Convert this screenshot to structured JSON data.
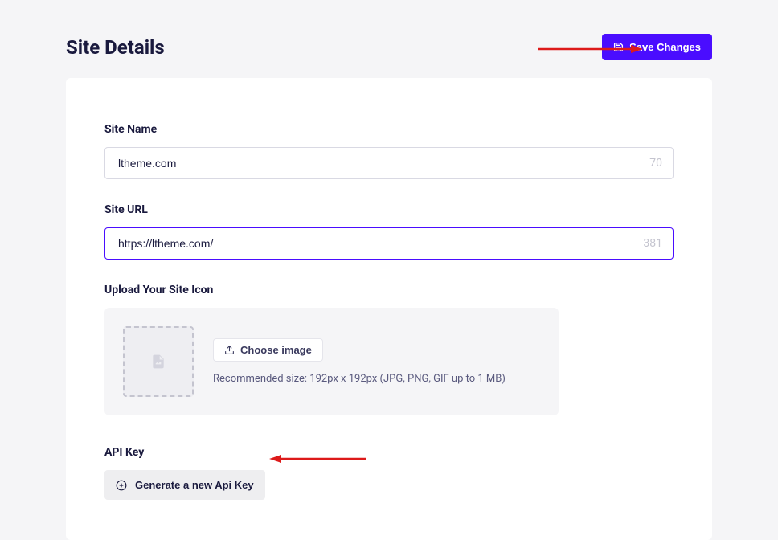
{
  "header": {
    "title": "Site Details",
    "save_button_label": "Save Changes"
  },
  "site_name": {
    "label": "Site Name",
    "value": "ltheme.com",
    "char_count": "70"
  },
  "site_url": {
    "label": "Site URL",
    "value": "https://ltheme.com/",
    "char_count": "381"
  },
  "upload_icon": {
    "label": "Upload Your Site Icon",
    "button_label": "Choose image",
    "hint": "Recommended size: 192px x 192px (JPG, PNG, GIF up to 1 MB)"
  },
  "api_key": {
    "label": "API Key",
    "button_label": "Generate a new Api Key"
  },
  "colors": {
    "primary": "#4a0dff",
    "text_dark": "#1a1a3e",
    "bg_light": "#f5f5f7",
    "arrow": "#dd1a1a"
  }
}
